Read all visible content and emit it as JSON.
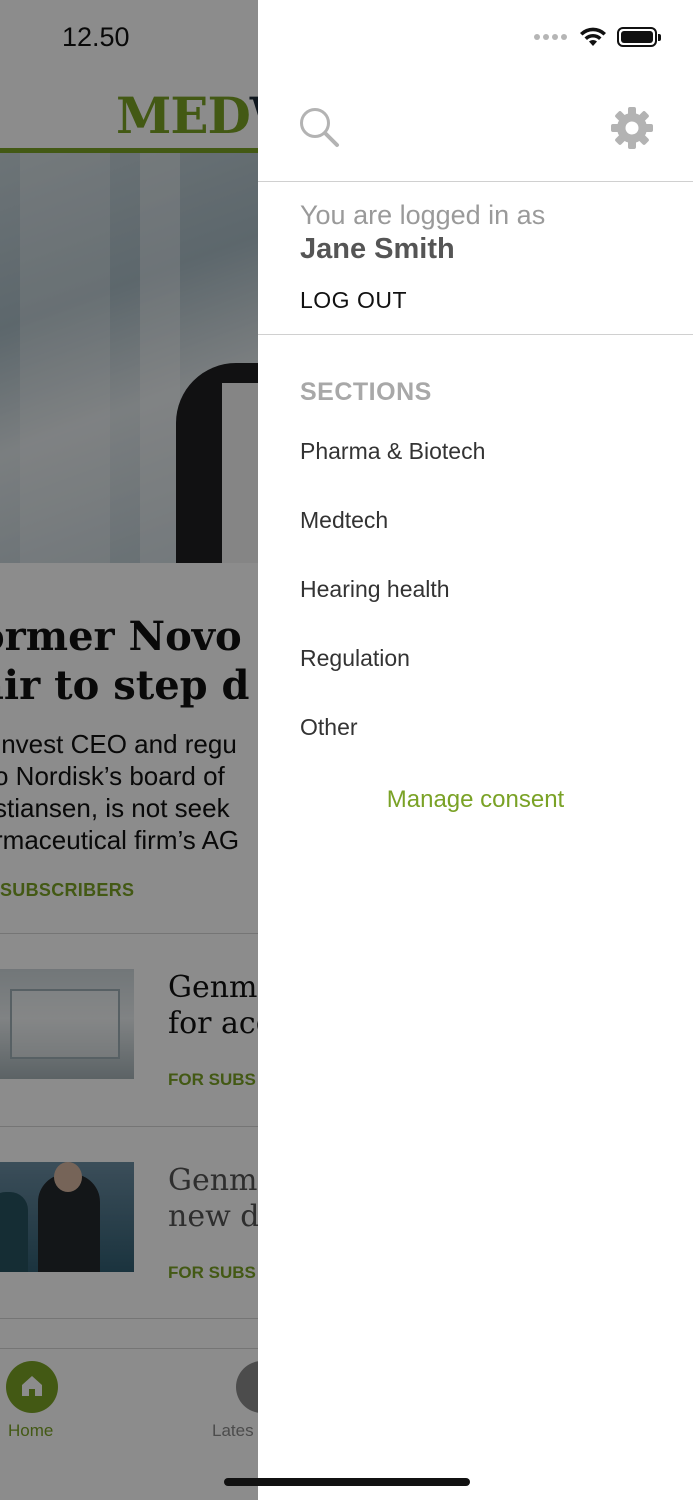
{
  "status_bar": {
    "time": "12.50"
  },
  "background": {
    "logo_green": "MED",
    "logo_dark": "W",
    "headline_line1": "ormer Novo",
    "headline_line2": "air to step d",
    "lead_lines": [
      "Invest CEO and regu",
      "o Nordisk’s board of",
      "stiansen, is not seek",
      "rmaceutical firm’s AG"
    ],
    "subscriber_tag": "SUBSCRIBERS",
    "articles": [
      {
        "title_line1": "Genma",
        "title_line2": "for acq",
        "tag": "FOR SUBS"
      },
      {
        "title_line1": "Genma",
        "title_line2": "new di",
        "tag": "FOR SUBS"
      }
    ],
    "tabs": {
      "home": "Home",
      "latest": "Lates"
    }
  },
  "drawer": {
    "logged_in_label": "You are logged in as",
    "user_name": "Jane Smith",
    "logout_label": "LOG OUT",
    "sections_heading": "SECTIONS",
    "sections": [
      "Pharma & Biotech",
      "Medtech",
      "Hearing health",
      "Regulation",
      "Other"
    ],
    "manage_consent": "Manage consent"
  },
  "colors": {
    "accent": "#7aa226",
    "overlay": "rgba(0,0,0,0.45)"
  },
  "icons": [
    "search-icon",
    "gear-icon",
    "wifi-icon",
    "battery-icon",
    "signal-dots-icon",
    "home-icon"
  ]
}
